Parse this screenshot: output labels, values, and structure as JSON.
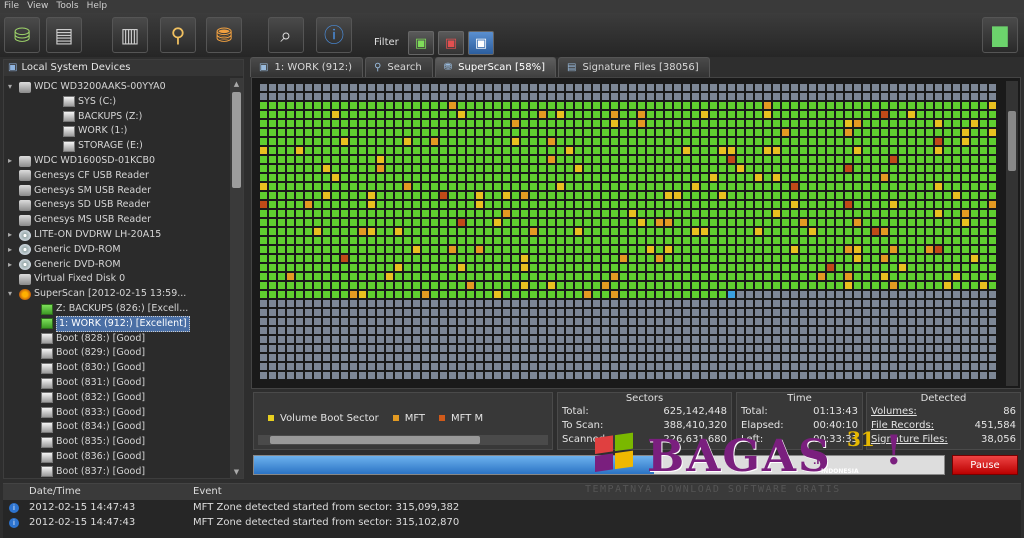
{
  "menu": [
    "File",
    "View",
    "Tools",
    "Help"
  ],
  "toolbar": {
    "filter_label": "Filter"
  },
  "left_panel": {
    "title": "Local System Devices",
    "items": [
      {
        "label": "WDC WD3200AAKS-00YYA0",
        "icon": "drive",
        "level": 0,
        "exp": "▾"
      },
      {
        "label": "SYS (C:)",
        "icon": "part",
        "level": 2
      },
      {
        "label": "BACKUPS (Z:)",
        "icon": "part",
        "level": 2
      },
      {
        "label": "WORK (1:)",
        "icon": "part",
        "level": 2
      },
      {
        "label": "STORAGE (E:)",
        "icon": "part",
        "level": 2
      },
      {
        "label": "WDC WD1600SD-01KCB0",
        "icon": "drive",
        "level": 0,
        "exp": "▸"
      },
      {
        "label": "Genesys  CF  USB Reader",
        "icon": "drive",
        "level": 0
      },
      {
        "label": "Genesys  SM  USB Reader",
        "icon": "drive",
        "level": 0
      },
      {
        "label": "Genesys  SD  USB Reader",
        "icon": "drive",
        "level": 0
      },
      {
        "label": "Genesys  MS  USB Reader",
        "icon": "drive",
        "level": 0
      },
      {
        "label": "LITE-ON DVDRW LH-20A15",
        "icon": "disc",
        "level": 0,
        "exp": "▸"
      },
      {
        "label": "Generic DVD-ROM",
        "icon": "disc",
        "level": 0,
        "exp": "▸"
      },
      {
        "label": "Generic DVD-ROM",
        "icon": "disc",
        "level": 0,
        "exp": "▸"
      },
      {
        "label": "Virtual Fixed Disk 0",
        "icon": "drive",
        "level": 0
      },
      {
        "label": "SuperScan [2012-02-15 13:59...",
        "icon": "scan",
        "level": 0,
        "exp": "▾"
      },
      {
        "label": "Z: BACKUPS (826:) [Excell...",
        "icon": "green",
        "level": 1
      },
      {
        "label": "1: WORK (912:) [Excellent]",
        "icon": "green",
        "level": 1,
        "selected": true
      },
      {
        "label": "Boot (828:) [Good]",
        "icon": "part",
        "level": 1
      },
      {
        "label": "Boot (829:) [Good]",
        "icon": "part",
        "level": 1
      },
      {
        "label": "Boot (830:) [Good]",
        "icon": "part",
        "level": 1
      },
      {
        "label": "Boot (831:) [Good]",
        "icon": "part",
        "level": 1
      },
      {
        "label": "Boot (832:) [Good]",
        "icon": "part",
        "level": 1
      },
      {
        "label": "Boot (833:) [Good]",
        "icon": "part",
        "level": 1
      },
      {
        "label": "Boot (834:) [Good]",
        "icon": "part",
        "level": 1
      },
      {
        "label": "Boot (835:) [Good]",
        "icon": "part",
        "level": 1
      },
      {
        "label": "Boot (836:) [Good]",
        "icon": "part",
        "level": 1
      },
      {
        "label": "Boot (837:) [Good]",
        "icon": "part",
        "level": 1
      }
    ]
  },
  "tabs": [
    {
      "label": "1: WORK (912:)",
      "icon": "disk-icon"
    },
    {
      "label": "Search",
      "icon": "search-icon"
    },
    {
      "label": "SuperScan [58%]",
      "icon": "scan-icon",
      "active": true
    },
    {
      "label": "Signature Files [38056]",
      "icon": "file-icon"
    }
  ],
  "legend": {
    "items": [
      {
        "label": "Volume Boot Sector",
        "color": "#e8d020"
      },
      {
        "label": "MFT",
        "color": "#e39a22"
      },
      {
        "label": "MFT M",
        "color": "#d05a1a"
      }
    ]
  },
  "sectors": {
    "title": "Sectors",
    "rows": [
      {
        "k": "Total:",
        "v": "625,142,448"
      },
      {
        "k": "To Scan:",
        "v": "388,410,320"
      },
      {
        "k": "Scanned:",
        "v": "226,631,680"
      }
    ]
  },
  "time": {
    "title": "Time",
    "rows": [
      {
        "k": "Total:",
        "v": "01:13:43"
      },
      {
        "k": "Elapsed:",
        "v": "00:40:10"
      },
      {
        "k": "Left:",
        "v": "00:33:33"
      }
    ]
  },
  "detected": {
    "title": "Detected",
    "rows": [
      {
        "k": "Volumes:",
        "v": "86"
      },
      {
        "k": "File Records:",
        "v": "451,584"
      },
      {
        "k": "Signature Files:",
        "v": "38,056"
      }
    ]
  },
  "progress": {
    "value": 0.58
  },
  "pause_label": "Pause",
  "log": {
    "col_date": "Date/Time",
    "col_event": "Event",
    "rows": [
      {
        "date": "2012-02-15 14:47:43",
        "event": "MFT Zone detected started from sector: 315,099,382"
      },
      {
        "date": "2012-02-15 14:47:43",
        "event": "MFT Zone detected started from sector: 315,102,870"
      }
    ]
  },
  "watermark": {
    "brand": "BAGAS",
    "num": "31",
    "excl": "!",
    "tld": ".id",
    "country": "INDONESIA",
    "tagline": "TEMPATNYA DOWNLOAD SOFTWARE GRATIS"
  },
  "colors": {
    "green": "#5fcf2f",
    "scanned_grey": "#7d8796",
    "yellow": "#e8c020",
    "orange": "#e39a22",
    "red": "#c04a18",
    "blue": "#3aa0e0"
  }
}
